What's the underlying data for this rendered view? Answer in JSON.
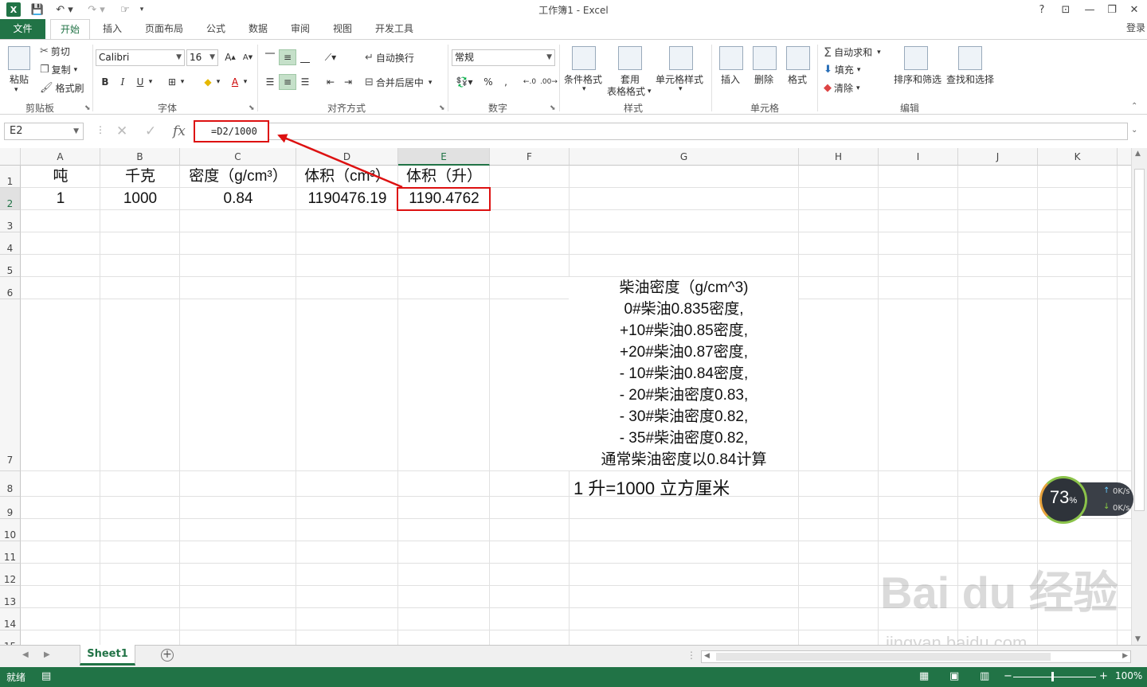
{
  "titlebar": {
    "app_logo": "X",
    "title": "工作簿1 - Excel",
    "buttons": {
      "help": "?",
      "ribbon_opts": "⊡",
      "minimize": "—",
      "restore": "❐",
      "close": "✕"
    }
  },
  "tabs": {
    "file": "文件",
    "items": [
      "开始",
      "插入",
      "页面布局",
      "公式",
      "数据",
      "审阅",
      "视图",
      "开发工具"
    ],
    "signin": "登录"
  },
  "ribbon": {
    "clipboard": {
      "paste": "粘贴",
      "cut": "剪切",
      "copy": "复制",
      "format_painter": "格式刷",
      "label": "剪贴板"
    },
    "font": {
      "name": "Calibri",
      "size": "16",
      "bold": "B",
      "italic": "I",
      "underline": "U",
      "label": "字体"
    },
    "align": {
      "wrap": "自动换行",
      "merge": "合并后居中",
      "label": "对齐方式"
    },
    "number": {
      "format": "常规",
      "percent": "%",
      "comma": ",",
      "label": "数字"
    },
    "styles": {
      "conditional": "条件格式",
      "table_l1": "套用",
      "table_l2": "表格格式",
      "cell_styles": "单元格样式",
      "label": "样式"
    },
    "cells": {
      "insert": "插入",
      "delete": "删除",
      "format": "格式",
      "label": "单元格"
    },
    "editing": {
      "autosum": "自动求和",
      "fill": "填充",
      "clear": "清除",
      "sort": "排序和筛选",
      "find": "查找和选择",
      "label": "编辑"
    }
  },
  "formula_bar": {
    "name_box": "E2",
    "formula": "=D2/1000",
    "fx": "fx"
  },
  "columns": [
    "A",
    "B",
    "C",
    "D",
    "E",
    "F",
    "G",
    "H",
    "I",
    "J",
    "K"
  ],
  "rows": [
    "1",
    "2",
    "3",
    "4",
    "5",
    "6",
    "7",
    "8",
    "9",
    "10",
    "11",
    "12",
    "13",
    "14",
    "15"
  ],
  "cells": {
    "A1": "吨",
    "B1": "千克",
    "C1": "密度（g/cm³）",
    "D1": "体积（cm³）",
    "E1": "体积（升）",
    "A2": "1",
    "B2": "1000",
    "C2": "0.84",
    "D2": "1190476.19",
    "E2": "1190.4762"
  },
  "note_g": [
    "柴油密度（g/cm^3)",
    "0#柴油0.835密度,",
    "+10#柴油0.85密度,",
    "+20#柴油0.87密度,",
    "- 10#柴油0.84密度,",
    "- 20#柴油密度0.83,",
    "- 30#柴油密度0.82,",
    "- 35#柴油密度0.82,",
    "通常柴油密度以0.84计算"
  ],
  "note_g8": "1 升=1000 立方厘米",
  "net_widget": {
    "percent": "73",
    "percent_sign": "%",
    "up": "0K/s",
    "down": "0K/s"
  },
  "watermark": {
    "main": "Bai du 经验",
    "sub": "jingyan.baidu.com"
  },
  "sheet_tabs": {
    "active": "Sheet1",
    "add": "+"
  },
  "status": {
    "ready": "就绪",
    "zoom": "100%",
    "zoom_minus": "−",
    "zoom_plus": "+"
  },
  "colors": {
    "accent": "#217346",
    "highlight": "#dd1111"
  }
}
